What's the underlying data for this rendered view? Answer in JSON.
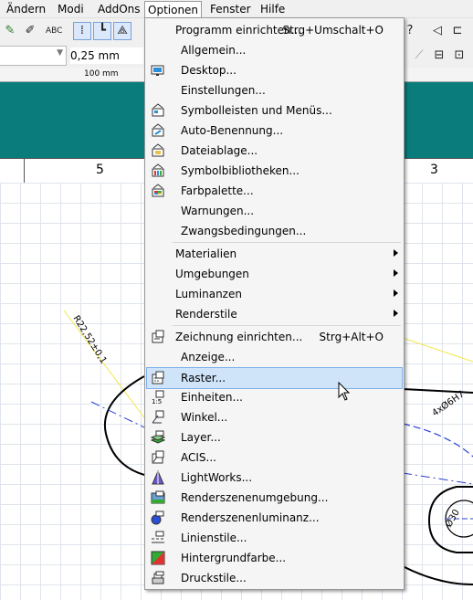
{
  "menubar": {
    "items": [
      {
        "label": "Ändern"
      },
      {
        "label": "Modi"
      },
      {
        "label": "AddOns"
      },
      {
        "label": "Optionen"
      },
      {
        "label": "Fenster"
      },
      {
        "label": "Hilfe"
      }
    ]
  },
  "toolbar": {
    "line_width": "0,25 mm"
  },
  "ruler": {
    "label": "100 mm"
  },
  "columns": {
    "left": "5",
    "right": "3"
  },
  "drawing": {
    "radius_label": "R22,52±0,1",
    "hole_label": "4xØ6H7",
    "dia_label": "Ø30"
  },
  "menu": {
    "items": [
      {
        "label": "Programm einrichten...",
        "shortcut": "Strg+Umschalt+O",
        "icon": "none"
      },
      {
        "label": "Allgemein...",
        "shortcut": "",
        "icon": "none"
      },
      {
        "label": "Desktop...",
        "shortcut": "",
        "icon": "desktop-icon"
      },
      {
        "label": "Einstellungen...",
        "shortcut": "",
        "icon": "none"
      },
      {
        "label": "Symbolleisten und Menüs...",
        "shortcut": "",
        "icon": "toolbars-icon"
      },
      {
        "label": "Auto-Benennung...",
        "shortcut": "",
        "icon": "auto-naming-icon"
      },
      {
        "label": "Dateiablage...",
        "shortcut": "",
        "icon": "file-storage-icon"
      },
      {
        "label": "Symbolbibliotheken...",
        "shortcut": "",
        "icon": "symbol-library-icon"
      },
      {
        "label": "Farbpalette...",
        "shortcut": "",
        "icon": "color-palette-icon"
      },
      {
        "label": "Warnungen...",
        "shortcut": "",
        "icon": "none"
      },
      {
        "label": "Zwangsbedingungen...",
        "shortcut": "",
        "icon": "none"
      },
      {
        "label": "Materialien",
        "shortcut": "",
        "icon": "none",
        "submenu": true
      },
      {
        "label": "Umgebungen",
        "shortcut": "",
        "icon": "none",
        "submenu": true
      },
      {
        "label": "Luminanzen",
        "shortcut": "",
        "icon": "none",
        "submenu": true
      },
      {
        "label": "Renderstile",
        "shortcut": "",
        "icon": "none",
        "submenu": true
      },
      {
        "label": "Zeichnung einrichten...",
        "shortcut": "Strg+Alt+O",
        "icon": "drawing-setup-icon"
      },
      {
        "label": "Anzeige...",
        "shortcut": "",
        "icon": "none"
      },
      {
        "label": "Raster...",
        "shortcut": "",
        "icon": "grid-icon"
      },
      {
        "label": "Einheiten...",
        "shortcut": "",
        "icon": "units-icon"
      },
      {
        "label": "Winkel...",
        "shortcut": "",
        "icon": "angle-icon"
      },
      {
        "label": "Layer...",
        "shortcut": "",
        "icon": "layer-icon"
      },
      {
        "label": "ACIS...",
        "shortcut": "",
        "icon": "acis-icon"
      },
      {
        "label": "LightWorks...",
        "shortcut": "",
        "icon": "lightworks-icon"
      },
      {
        "label": "Renderszenenumgebung...",
        "shortcut": "",
        "icon": "render-scene-icon"
      },
      {
        "label": "Renderszenenluminanz...",
        "shortcut": "",
        "icon": "render-luminance-icon"
      },
      {
        "label": "Linienstile...",
        "shortcut": "",
        "icon": "line-styles-icon"
      },
      {
        "label": "Hintergrundfarbe...",
        "shortcut": "",
        "icon": "background-color-icon"
      },
      {
        "label": "Druckstile...",
        "shortcut": "",
        "icon": "print-styles-icon"
      }
    ]
  },
  "colors": {
    "accent_teal": "#0a7c7c",
    "highlight": "#cfe4f9",
    "dim_line_yellow": "#f2e74a",
    "center_line_blue": "#2a3fd0"
  }
}
